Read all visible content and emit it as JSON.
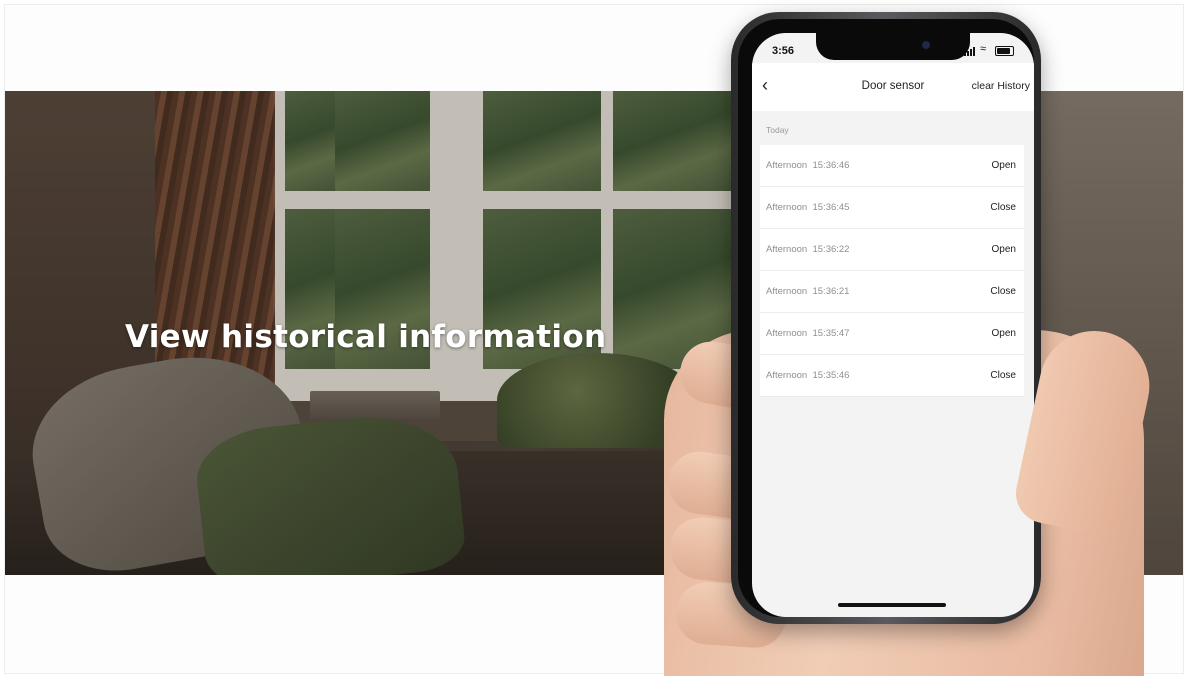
{
  "headline": "View historical information",
  "phone": {
    "status": {
      "time": "3:56"
    },
    "nav": {
      "back_icon": "chevron-left-icon",
      "title": "Door sensor",
      "clear_label": "clear History"
    },
    "section_label": "Today",
    "history": [
      {
        "period": "Afternoon",
        "time": "15:36:46",
        "state": "Open"
      },
      {
        "period": "Afternoon",
        "time": "15:36:45",
        "state": "Close"
      },
      {
        "period": "Afternoon",
        "time": "15:36:22",
        "state": "Open"
      },
      {
        "period": "Afternoon",
        "time": "15:36:21",
        "state": "Close"
      },
      {
        "period": "Afternoon",
        "time": "15:35:47",
        "state": "Open"
      },
      {
        "period": "Afternoon",
        "time": "15:35:46",
        "state": "Close"
      }
    ]
  },
  "colors": {
    "screen_bg": "#f3f3f3",
    "text": "#222222",
    "muted": "#8f8f8f"
  }
}
